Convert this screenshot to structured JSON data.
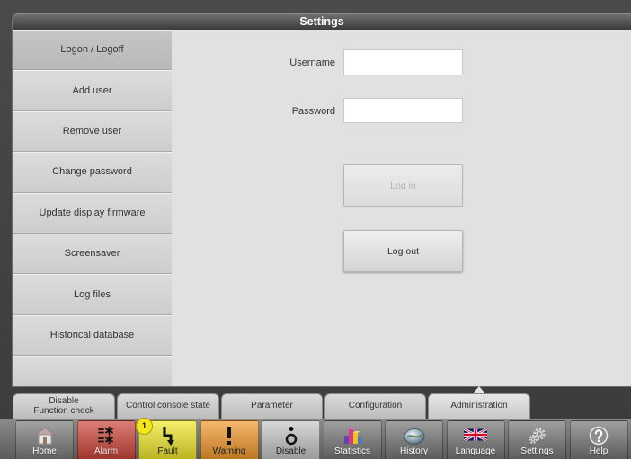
{
  "window": {
    "title": "Settings"
  },
  "sidebar": {
    "items": [
      {
        "label": "Logon / Logoff",
        "selected": true
      },
      {
        "label": "Add user"
      },
      {
        "label": "Remove user"
      },
      {
        "label": "Change password"
      },
      {
        "label": "Update display firmware"
      },
      {
        "label": "Screensaver"
      },
      {
        "label": "Log files"
      },
      {
        "label": "Historical database"
      }
    ]
  },
  "logon_form": {
    "username": {
      "label": "Username",
      "value": ""
    },
    "password": {
      "label": "Password",
      "value": ""
    },
    "login_button": {
      "label": "Log in",
      "disabled": true
    },
    "logout_button": {
      "label": "Log out",
      "disabled": false
    }
  },
  "tabs": {
    "items": [
      {
        "label_lines": [
          "Disable",
          "Function check"
        ]
      },
      {
        "label": "Control console state"
      },
      {
        "label": "Parameter"
      },
      {
        "label": "Configuration"
      },
      {
        "label": "Administration",
        "selected": true
      }
    ]
  },
  "toolbar": {
    "items": [
      {
        "label": "Home",
        "icon": "home-icon",
        "color": "#7b7b7b"
      },
      {
        "label": "Alarm",
        "icon": "alarm-icon",
        "color": "#cc463b"
      },
      {
        "label": "Fault",
        "icon": "fault-icon",
        "color": "#efe82c",
        "badge": "1"
      },
      {
        "label": "Warning",
        "icon": "warning-icon",
        "color": "#f1982c"
      },
      {
        "label": "Disable",
        "icon": "disable-icon",
        "color": "#c6c6c6"
      },
      {
        "label": "Statistics",
        "icon": "statistics-icon",
        "color": "#767676"
      },
      {
        "label": "History",
        "icon": "history-icon",
        "color": "#767676"
      },
      {
        "label": "Language",
        "icon": "uk-flag-icon",
        "color": "#767676"
      },
      {
        "label": "Settings",
        "icon": "settings-gears-icon",
        "color": "#767676"
      },
      {
        "label": "Help",
        "icon": "help-icon",
        "color": "#767676"
      }
    ]
  }
}
